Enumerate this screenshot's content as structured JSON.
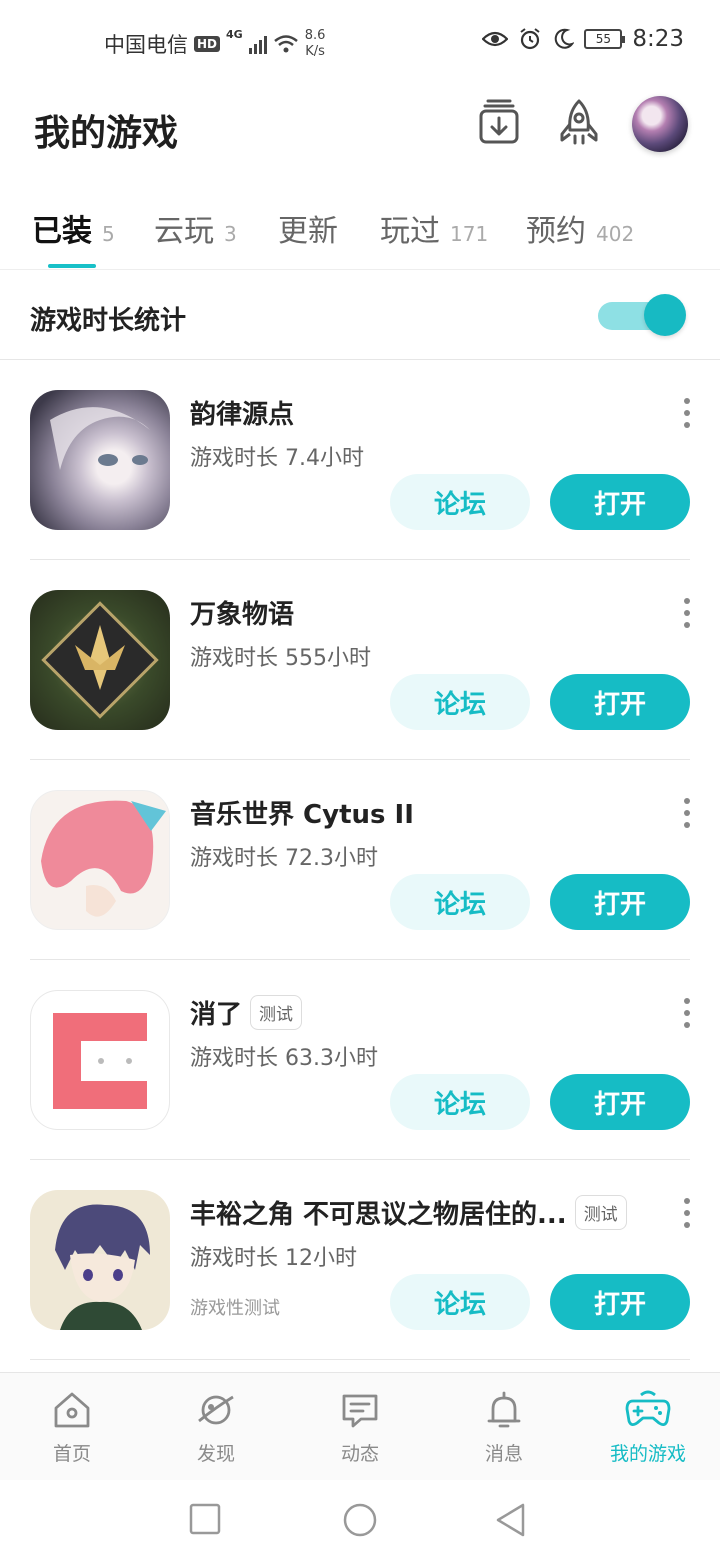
{
  "status_bar": {
    "carrier": "中国电信",
    "hd": "HD",
    "network": "4G",
    "speed_value": "8.6",
    "speed_unit": "K/s",
    "battery": "55",
    "time": "8:23"
  },
  "header": {
    "title": "我的游戏"
  },
  "tabs": [
    {
      "label": "已装",
      "count": "5",
      "active": true
    },
    {
      "label": "云玩",
      "count": "3"
    },
    {
      "label": "更新",
      "count": ""
    },
    {
      "label": "玩过",
      "count": "171"
    },
    {
      "label": "预约",
      "count": "402"
    }
  ],
  "stats": {
    "label": "游戏时长统计",
    "enabled": true
  },
  "games": [
    {
      "name": "韵律源点",
      "tag": "",
      "time": "游戏时长 7.4小时",
      "sub": "",
      "forum": "论坛",
      "open": "打开"
    },
    {
      "name": "万象物语",
      "tag": "",
      "time": "游戏时长 555小时",
      "sub": "",
      "forum": "论坛",
      "open": "打开"
    },
    {
      "name": "音乐世界 Cytus II",
      "tag": "",
      "time": "游戏时长 72.3小时",
      "sub": "",
      "forum": "论坛",
      "open": "打开"
    },
    {
      "name": "消了",
      "tag": "测试",
      "time": "游戏时长 63.3小时",
      "sub": "",
      "forum": "论坛",
      "open": "打开"
    },
    {
      "name": "丰裕之角 不可思议之物居住的...",
      "tag": "测试",
      "time": "游戏时长 12小时",
      "sub": "游戏性测试",
      "forum": "论坛",
      "open": "打开"
    }
  ],
  "bottom_nav": [
    {
      "label": "首页",
      "icon": "home-icon"
    },
    {
      "label": "发现",
      "icon": "discover-planet-icon"
    },
    {
      "label": "动态",
      "icon": "feed-message-icon"
    },
    {
      "label": "消息",
      "icon": "bell-icon"
    },
    {
      "label": "我的游戏",
      "icon": "gamepad-icon",
      "active": true
    }
  ],
  "colors": {
    "accent": "#16bcc5",
    "accent_light": "#e9f9fa"
  }
}
